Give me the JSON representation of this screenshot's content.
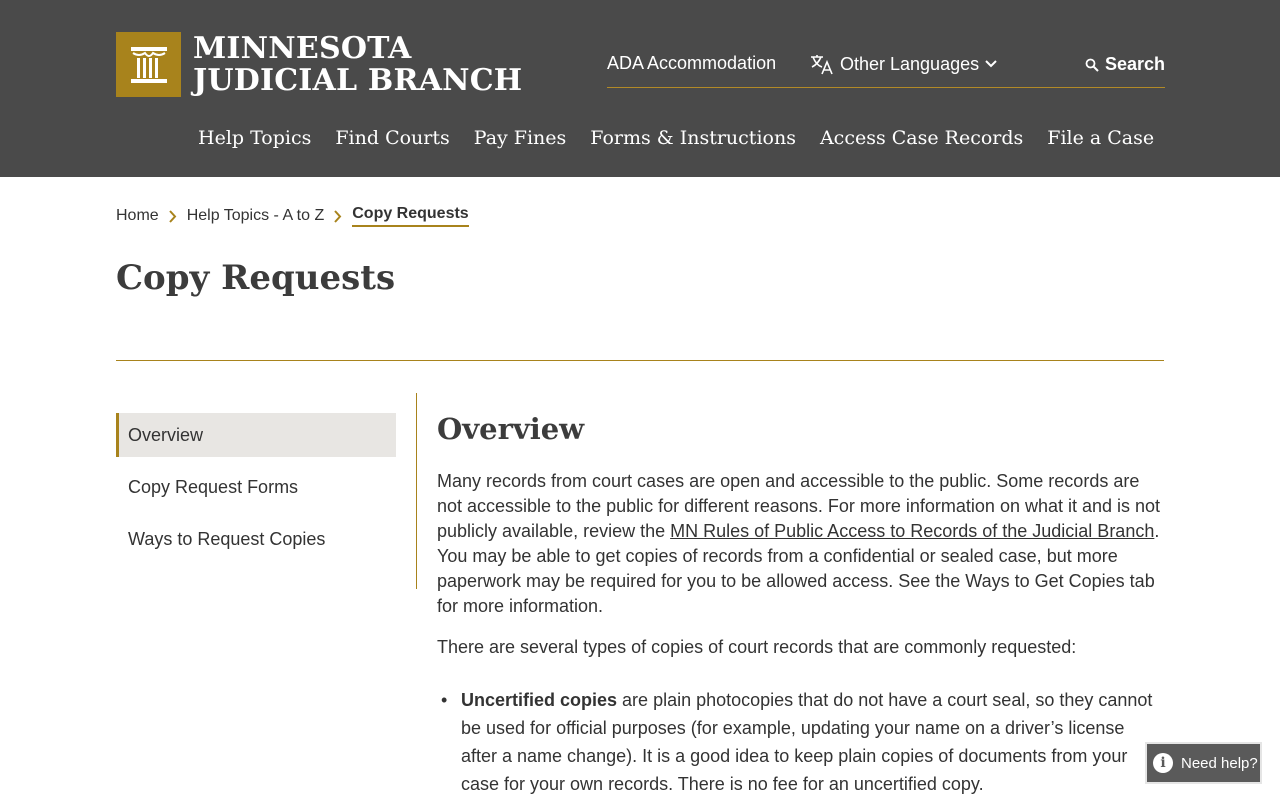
{
  "brand": {
    "line1": "MINNESOTA",
    "line2": "JUDICIAL BRANCH",
    "logo_icon": "courthouse-columns-icon",
    "accent_color": "#a8831c",
    "header_bg": "#4a4a4a"
  },
  "utility": {
    "ada": "ADA Accommodation",
    "languages": "Other Languages",
    "search": "Search"
  },
  "nav": {
    "items": [
      "Help Topics",
      "Find Courts",
      "Pay Fines",
      "Forms & Instructions",
      "Access Case Records",
      "File a Case"
    ]
  },
  "breadcrumb": {
    "home": "Home",
    "parent": "Help Topics - A to Z",
    "current": "Copy Requests"
  },
  "page": {
    "title": "Copy Requests"
  },
  "sidenav": {
    "items": [
      "Overview",
      "Copy Request Forms",
      "Ways to Request Copies"
    ],
    "active_index": 0
  },
  "content": {
    "section_title": "Overview",
    "p1_before": "Many records from court cases are open and accessible to the public. Some records are not accessible to the public for different reasons. For more information on what it and is not publicly available, review the ",
    "p1_link": "MN Rules of Public Access to Records of the Judicial Branch",
    "p1_after": ". You may be able to get copies of records from a confidential or sealed case, but more paperwork may be required for you to be allowed access. See the Ways to Get Copies tab for more information.",
    "p2": "There are several types of copies of court records that are commonly requested:",
    "bullet1_bold": "Uncertified copies",
    "bullet1_text": " are plain photocopies that do not have a court seal, so they cannot be used for official purposes (for example, updating your name on a driver’s license after a name change). It is a good idea to keep plain copies of documents from your case for your own records. There is no fee for an uncertified copy."
  },
  "help": {
    "label": "Need help?"
  }
}
